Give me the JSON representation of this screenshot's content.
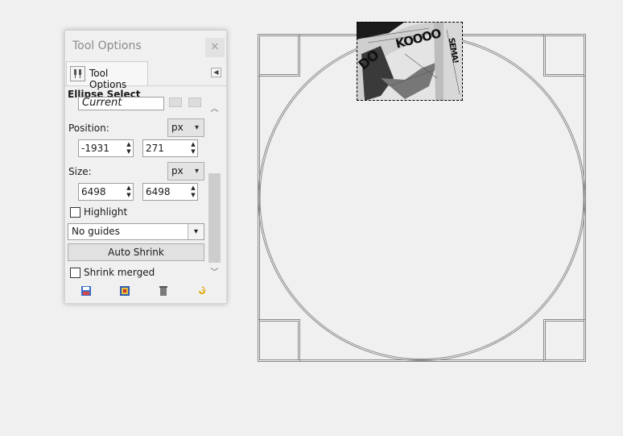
{
  "dock": {
    "title": "Tool Options",
    "close_icon": "close-icon",
    "tab_label": "Tool Options",
    "tab_icon": "tool-options-icon",
    "tab_menu_icon": "tab-menu-arrow-icon"
  },
  "tool_options": {
    "section_title": "Ellipse Select",
    "mode_value": "Current",
    "position": {
      "label": "Position:",
      "unit": "px",
      "x": "-1931",
      "y": "271"
    },
    "size": {
      "label": "Size:",
      "unit": "px",
      "width": "6498",
      "height": "6498"
    },
    "highlight_label": "Highlight",
    "guides_value": "No guides",
    "auto_shrink_label": "Auto Shrink",
    "shrink_merged_label": "Shrink merged"
  },
  "footer_icons": [
    "save-preset-icon",
    "restore-preset-icon",
    "delete-preset-icon",
    "reset-icon"
  ],
  "canvas": {
    "thumbnail_text": [
      "KOOOO",
      "DO",
      "SEMA!"
    ]
  },
  "colors": {
    "background": "#f0f0f0",
    "guide_lines": "#8a8a8a",
    "selection": "#000000"
  }
}
